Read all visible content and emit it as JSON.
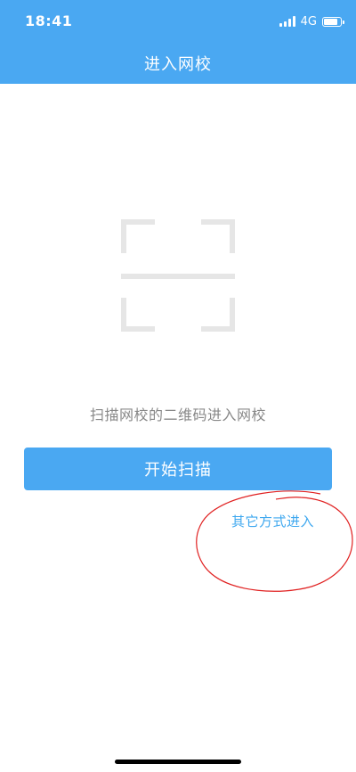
{
  "status_bar": {
    "time": "18:41",
    "network": "4G",
    "icons": [
      "signal-icon",
      "battery-icon"
    ]
  },
  "header": {
    "title": "进入网校"
  },
  "main": {
    "scan_icon": "scan-frame-icon",
    "hint": "扫描网校的二维码进入网校",
    "start_button_label": "开始扫描",
    "other_method_label": "其它方式进入"
  },
  "colors": {
    "primary": "#4aa8f2",
    "link": "#3fa8ef",
    "hint_text": "#888888",
    "scan_icon": "#e6e6e6",
    "annotation": "#e02020"
  }
}
